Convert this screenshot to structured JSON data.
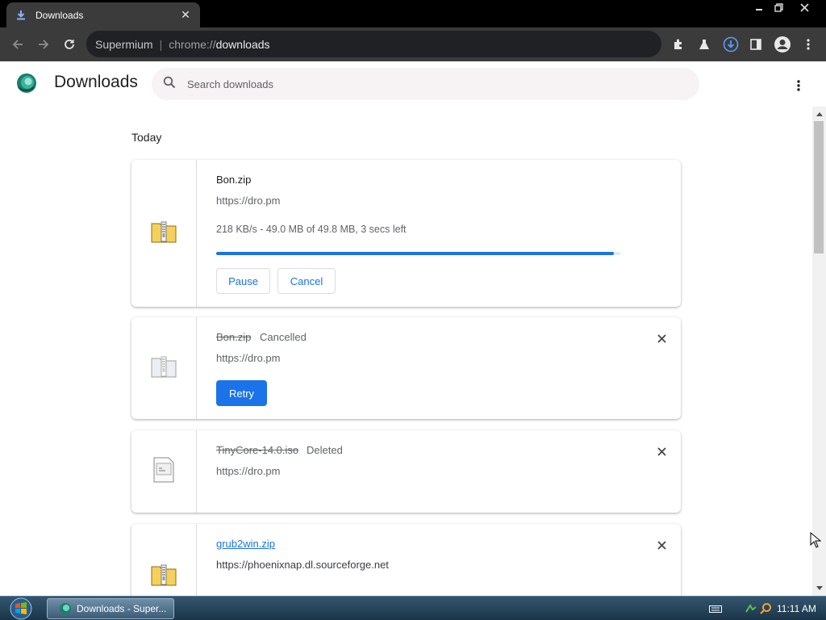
{
  "window": {
    "tab_title": "Downloads"
  },
  "toolbar": {
    "omnibox_site": "Supermium",
    "omnibox_separator": "|",
    "omnibox_scheme": "chrome://",
    "omnibox_path": "downloads"
  },
  "page": {
    "title": "Downloads",
    "search_placeholder": "Search downloads",
    "section_label": "Today"
  },
  "downloads": [
    {
      "name": "Bon.zip",
      "url": "https://dro.pm",
      "progress_text": "218 KB/s - 49.0 MB of 49.8 MB, 3 secs left",
      "progress_fraction": 0.984,
      "pause_label": "Pause",
      "cancel_label": "Cancel"
    },
    {
      "name": "Bon.zip",
      "status": "Cancelled",
      "url": "https://dro.pm",
      "retry_label": "Retry"
    },
    {
      "name": "TinyCore-14.0.iso",
      "status": "Deleted",
      "url": "https://dro.pm"
    },
    {
      "name": "grub2win.zip",
      "url": "https://phoenixnap.dl.sourceforge.net"
    }
  ],
  "taskbar": {
    "task_label": "Downloads - Super...",
    "clock": "11:11 AM"
  },
  "colors": {
    "accent": "#1a73e8",
    "browser_frame": "#3b3b3b",
    "taskbar": "#1b3448"
  }
}
